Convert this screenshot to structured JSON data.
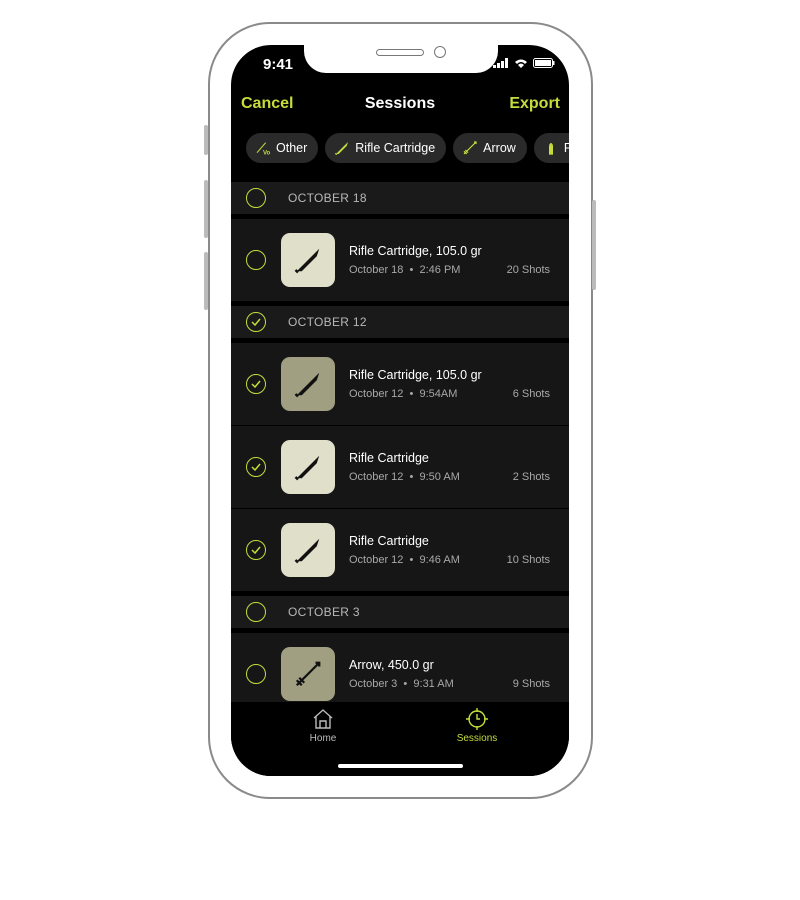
{
  "status": {
    "time": "9:41"
  },
  "nav": {
    "cancel": "Cancel",
    "title": "Sessions",
    "export": "Export"
  },
  "chips": [
    {
      "label": "Other",
      "icon": "velocity-icon"
    },
    {
      "label": "Rifle Cartridge",
      "icon": "rifle-cartridge-icon"
    },
    {
      "label": "Arrow",
      "icon": "arrow-icon"
    },
    {
      "label": "Pis",
      "icon": "pistol-cartridge-icon"
    }
  ],
  "sections": [
    {
      "date": "OCTOBER 18",
      "checked": false,
      "rows": [
        {
          "title": "Rifle Cartridge, 105.0 gr",
          "date": "October 18",
          "time": "2:46 PM",
          "shots": "20 Shots",
          "checked": false,
          "icon": "rifle-cartridge-icon"
        }
      ]
    },
    {
      "date": "OCTOBER 12",
      "checked": true,
      "rows": [
        {
          "title": "Rifle Cartridge, 105.0 gr",
          "date": "October 12",
          "time": "9:54AM",
          "shots": "6 Shots",
          "checked": true,
          "icon": "rifle-cartridge-icon"
        },
        {
          "title": "Rifle Cartridge",
          "date": "October 12",
          "time": "9:50 AM",
          "shots": "2 Shots",
          "checked": true,
          "icon": "rifle-cartridge-icon"
        },
        {
          "title": "Rifle Cartridge",
          "date": "October 12",
          "time": "9:46 AM",
          "shots": "10 Shots",
          "checked": true,
          "icon": "rifle-cartridge-icon"
        }
      ]
    },
    {
      "date": "OCTOBER 3",
      "checked": false,
      "rows": [
        {
          "title": "Arrow, 450.0 gr",
          "date": "October 3",
          "time": "9:31 AM",
          "shots": "9 Shots",
          "checked": false,
          "icon": "arrow-icon"
        }
      ]
    }
  ],
  "tabs": [
    {
      "label": "Home",
      "active": false
    },
    {
      "label": "Sessions",
      "active": true
    }
  ],
  "colors": {
    "accent": "#c5dc3a",
    "tile_light": "#e0dfca",
    "tile_dark": "#a09f82"
  }
}
